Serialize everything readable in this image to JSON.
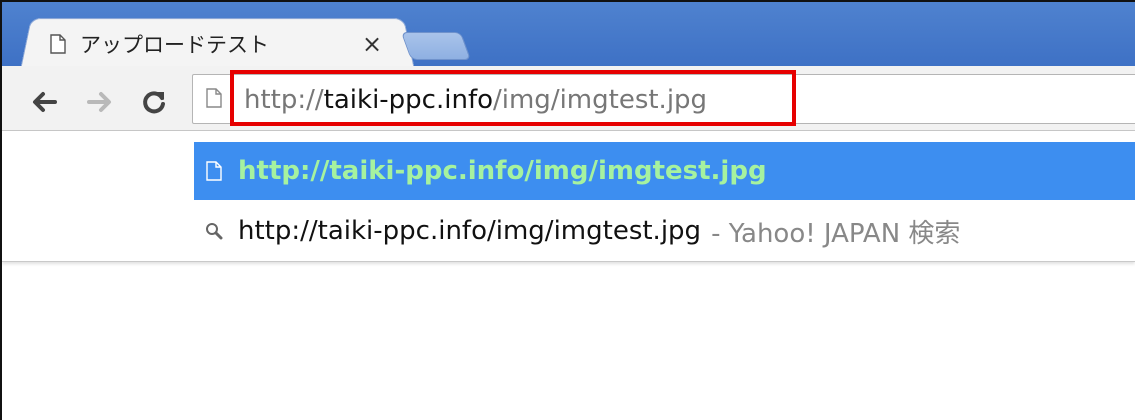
{
  "tab": {
    "title": "アップロードテスト",
    "close_glyph": "×",
    "icon": "page-icon"
  },
  "toolbar": {
    "back_icon": "back-arrow-icon",
    "forward_icon": "forward-arrow-icon",
    "reload_icon": "reload-icon"
  },
  "omnibox": {
    "icon": "page-icon",
    "url_scheme": "http://",
    "url_host": "taiki-ppc.info",
    "url_path": "/img/imgtest.jpg"
  },
  "suggestions": [
    {
      "icon": "page-icon",
      "text": "http://taiki-ppc.info/img/imgtest.jpg",
      "suffix": "",
      "selected": true
    },
    {
      "icon": "search-icon",
      "text": "http://taiki-ppc.info/img/imgtest.jpg",
      "suffix": "- Yahoo! JAPAN 検索",
      "selected": false
    }
  ],
  "colors": {
    "tabstrip": "#4f82cf",
    "highlight_border": "#e60000",
    "selected_row": "#3d8ef0",
    "selected_text": "#a6f29f"
  }
}
